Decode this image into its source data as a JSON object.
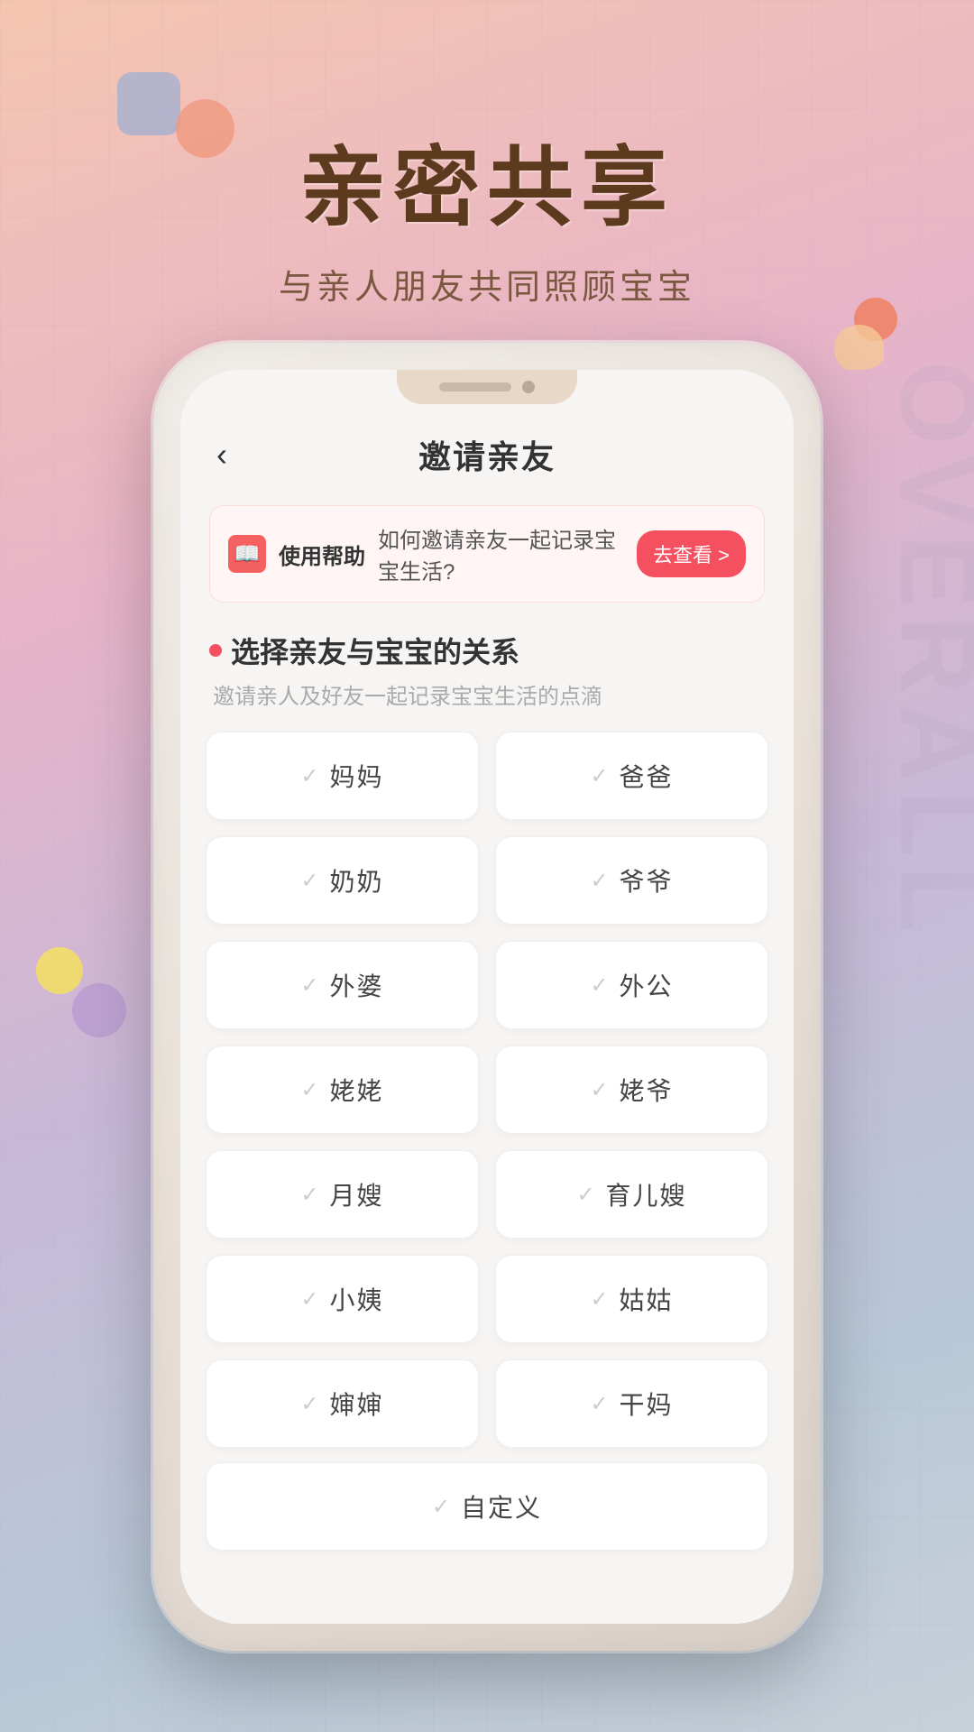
{
  "background": {
    "watermark": "OVERALL"
  },
  "header": {
    "main_title": "亲密共享",
    "sub_title": "与亲人朋友共同照顾宝宝"
  },
  "phone": {
    "nav": {
      "back_icon": "‹",
      "title": "邀请亲友"
    },
    "help_banner": {
      "icon_text": "?",
      "label": "使用帮助",
      "text": "如何邀请亲友一起记录宝宝生活?",
      "button": "去查看 >"
    },
    "section": {
      "title": "选择亲友与宝宝的关系",
      "subtitle": "邀请亲人及好友一起记录宝宝生活的点滴"
    },
    "relations": [
      {
        "id": "mama",
        "name": "妈妈",
        "checked": false
      },
      {
        "id": "baba",
        "name": "爸爸",
        "checked": false
      },
      {
        "id": "nainai",
        "name": "奶奶",
        "checked": false
      },
      {
        "id": "yeye",
        "name": "爷爷",
        "checked": false
      },
      {
        "id": "waipo",
        "name": "外婆",
        "checked": false
      },
      {
        "id": "waigong",
        "name": "外公",
        "checked": false
      },
      {
        "id": "jiaojiao",
        "name": "姥姥",
        "checked": false
      },
      {
        "id": "jiaoye",
        "name": "姥爷",
        "checked": false
      },
      {
        "id": "yuesao",
        "name": "月嫂",
        "checked": false
      },
      {
        "id": "yuersao",
        "name": "育儿嫂",
        "checked": false
      },
      {
        "id": "xiaoyue",
        "name": "小姨",
        "checked": false
      },
      {
        "id": "gugu",
        "name": "姑姑",
        "checked": false
      },
      {
        "id": "bianbian",
        "name": "婶婶",
        "checked": false
      },
      {
        "id": "ganma",
        "name": "干妈",
        "checked": false
      }
    ],
    "custom": {
      "name": "自定义",
      "checked": false
    }
  }
}
